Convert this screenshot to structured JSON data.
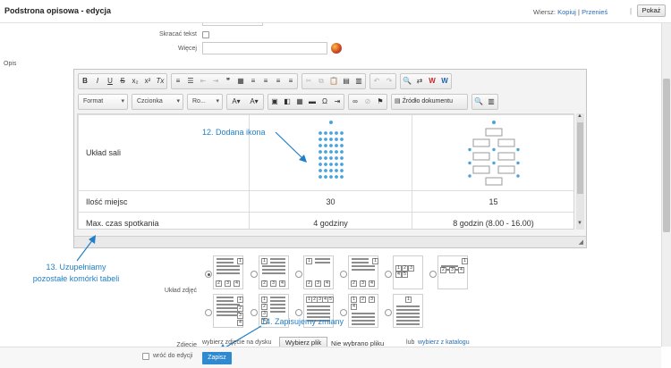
{
  "header": {
    "title": "Podstrona opisowa - edycja",
    "wiersz_label": "Wiersz:",
    "kopiuj": "Kopiuj",
    "sep": "|",
    "przenies": "Przenieś",
    "pokaz": "Pokaż"
  },
  "form": {
    "skracac_label": "Skracać tekst",
    "wiecej_label": "Więcej",
    "opis_label": "Opis",
    "uklad_label": "Układ zdjęć",
    "zdjecie_label": "Zdjęcie",
    "upload_text": "wybierz zdjęcie na dysku",
    "file_button": "Wybierz plik",
    "no_file": "Nie wybrano pliku",
    "lub": "lub",
    "catalog_link": "wybierz z katalogu",
    "back_checkbox_label": "wróć do edycji",
    "save_button": "Zapisz"
  },
  "toolbar": {
    "row1": [
      {
        "name": "bold-button",
        "glyph": "B"
      },
      {
        "name": "italic-button",
        "glyph": "I"
      },
      {
        "name": "underline-button",
        "glyph": "U"
      },
      {
        "name": "strike-button",
        "glyph": "S"
      },
      {
        "name": "subscript-button",
        "glyph": "x₂"
      },
      {
        "name": "superscript-button",
        "glyph": "x²"
      },
      {
        "name": "remove-format-button",
        "glyph": "Tx"
      }
    ],
    "combos": {
      "format": "Format",
      "font": "Czcionka",
      "size": "Ro..."
    },
    "source_button": "Źródło dokumentu",
    "colors": {
      "red_w": "#c62828",
      "blue_w": "#1f5fb5"
    }
  },
  "table": {
    "rows": [
      {
        "label": "Układ sali",
        "col1": "",
        "col2": ""
      },
      {
        "label": "Ilość miejsc",
        "col1": "30",
        "col2": "15"
      },
      {
        "label": "Max. czas spotkania",
        "col1": "4 godziny",
        "col2": "8 godzin (8.00 - 16.00)"
      }
    ]
  },
  "annotations": {
    "a12": "12. Dodana ikona",
    "a13_line1": "13. Uzupełniamy",
    "a13_line2": "pozostałe komórki tabeli",
    "a14": "14. Zapisujemy zmiany",
    "color": "#1f7fc9"
  },
  "layouts": {
    "row1_labels": [
      [
        "1",
        "2",
        "3",
        "4"
      ],
      [
        "1",
        "2",
        "3",
        "4"
      ],
      [
        "1",
        "2",
        "3",
        "4"
      ],
      [
        "1",
        "2",
        "3",
        "4"
      ],
      [
        "1",
        "2",
        "3",
        "4",
        "5"
      ],
      [
        "1",
        "2",
        "3",
        "4"
      ]
    ],
    "row2_labels": [
      [
        "1",
        "2",
        "3",
        "4"
      ],
      [
        "1",
        "2",
        "3",
        "4"
      ],
      [
        "1",
        "2",
        "3",
        "4",
        "5"
      ],
      [
        "1",
        "2",
        "3",
        "4"
      ],
      [
        "1"
      ]
    ]
  }
}
